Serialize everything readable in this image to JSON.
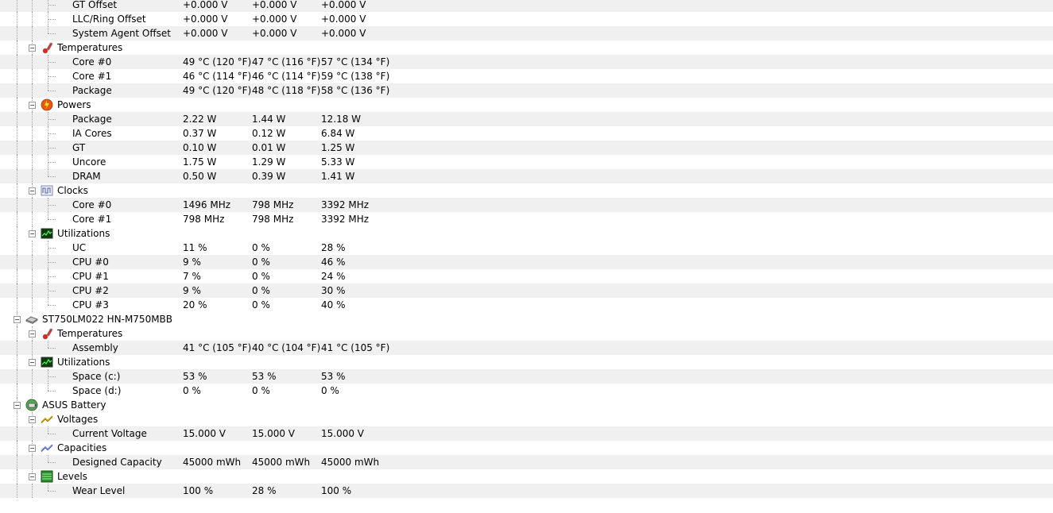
{
  "header": {
    "labels": [
      "",
      "",
      "",
      ""
    ]
  },
  "rows": [
    {
      "label": "GT Offset",
      "value": "+0.000 V",
      "min": "+0.000 V",
      "max": "+0.000 V",
      "level": 2
    },
    {
      "label": "LLC/Ring Offset",
      "value": "+0.000 V",
      "min": "+0.000 V",
      "max": "+0.000 V",
      "level": 2
    },
    {
      "label": "System Agent Offset",
      "value": "+0.000 V",
      "min": "+0.000 V",
      "max": "+0.000 V",
      "level": 2,
      "last": true
    },
    {
      "label": "Temperatures",
      "level": 1,
      "icon": "thermometer-icon",
      "expander": true
    },
    {
      "label": "Core #0",
      "value": "49 °C  (120 °F)",
      "min": "47 °C  (116 °F)",
      "max": "57 °C  (134 °F)",
      "level": 2
    },
    {
      "label": "Core #1",
      "value": "46 °C  (114 °F)",
      "min": "46 °C  (114 °F)",
      "max": "59 °C  (138 °F)",
      "level": 2
    },
    {
      "label": "Package",
      "value": "49 °C  (120 °F)",
      "min": "48 °C  (118 °F)",
      "max": "58 °C  (136 °F)",
      "level": 2,
      "last": true
    },
    {
      "label": "Powers",
      "level": 1,
      "icon": "power-icon",
      "expander": true
    },
    {
      "label": "Package",
      "value": "2.22 W",
      "min": "1.44 W",
      "max": "12.18 W",
      "level": 2
    },
    {
      "label": "IA Cores",
      "value": "0.37 W",
      "min": "0.12 W",
      "max": "6.84 W",
      "level": 2
    },
    {
      "label": "GT",
      "value": "0.10 W",
      "min": "0.01 W",
      "max": "1.25 W",
      "level": 2
    },
    {
      "label": "Uncore",
      "value": "1.75 W",
      "min": "1.29 W",
      "max": "5.33 W",
      "level": 2
    },
    {
      "label": "DRAM",
      "value": "0.50 W",
      "min": "0.39 W",
      "max": "1.41 W",
      "level": 2,
      "last": true
    },
    {
      "label": "Clocks",
      "level": 1,
      "icon": "clock-wave-icon",
      "expander": true
    },
    {
      "label": "Core #0",
      "value": "1496 MHz",
      "min": "798 MHz",
      "max": "3392 MHz",
      "level": 2
    },
    {
      "label": "Core #1",
      "value": "798 MHz",
      "min": "798 MHz",
      "max": "3392 MHz",
      "level": 2,
      "last": true
    },
    {
      "label": "Utilizations",
      "level": 1,
      "icon": "utilization-graph-icon",
      "expander": true
    },
    {
      "label": "UC",
      "value": "11 %",
      "min": "0 %",
      "max": "28 %",
      "level": 2
    },
    {
      "label": "CPU #0",
      "value": "9 %",
      "min": "0 %",
      "max": "46 %",
      "level": 2
    },
    {
      "label": "CPU #1",
      "value": "7 %",
      "min": "0 %",
      "max": "24 %",
      "level": 2
    },
    {
      "label": "CPU #2",
      "value": "9 %",
      "min": "0 %",
      "max": "30 %",
      "level": 2
    },
    {
      "label": "CPU #3",
      "value": "20 %",
      "min": "0 %",
      "max": "40 %",
      "level": 2,
      "last": true
    },
    {
      "label": "ST750LM022 HN-M750MBB",
      "level": 0,
      "icon": "hard-drive-icon",
      "expander": true
    },
    {
      "label": "Temperatures",
      "level": 1,
      "icon": "thermometer-icon",
      "expander": true
    },
    {
      "label": "Assembly",
      "value": "41 °C  (105 °F)",
      "min": "40 °C  (104 °F)",
      "max": "41 °C  (105 °F)",
      "level": 2,
      "last": true
    },
    {
      "label": "Utilizations",
      "level": 1,
      "icon": "utilization-graph-icon",
      "expander": true,
      "lastGroup": true
    },
    {
      "label": "Space (c:)",
      "value": "53 %",
      "min": "53 %",
      "max": "53 %",
      "level": 2
    },
    {
      "label": "Space (d:)",
      "value": "0 %",
      "min": "0 %",
      "max": "0 %",
      "level": 2,
      "last": true
    },
    {
      "label": "ASUS Battery",
      "level": 0,
      "icon": "battery-icon",
      "expander": true
    },
    {
      "label": "Voltages",
      "level": 1,
      "icon": "voltage-icon",
      "expander": true
    },
    {
      "label": "Current Voltage",
      "value": "15.000 V",
      "min": "15.000 V",
      "max": "15.000 V",
      "level": 2,
      "last": true
    },
    {
      "label": "Capacities",
      "level": 1,
      "icon": "capacity-icon",
      "expander": true
    },
    {
      "label": "Designed Capacity",
      "value": "45000 mWh",
      "min": "45000 mWh",
      "max": "45000 mWh",
      "level": 2,
      "last": true
    },
    {
      "label": "Levels",
      "level": 1,
      "icon": "levels-icon",
      "expander": true,
      "lastGroup": true
    },
    {
      "label": "Wear Level",
      "value": "100 %",
      "min": "28 %",
      "max": "100 %",
      "level": 2,
      "last": true
    }
  ]
}
